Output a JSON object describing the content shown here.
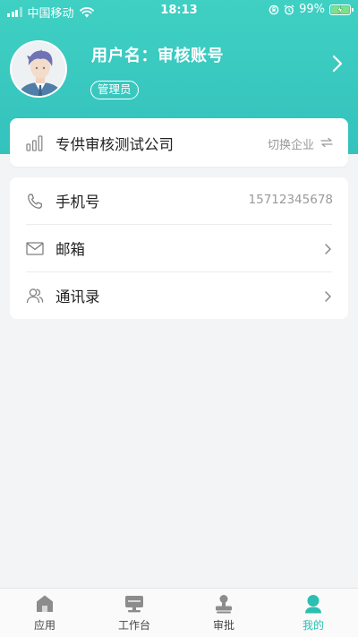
{
  "status_bar": {
    "carrier": "中国移动",
    "time": "18:13",
    "battery_percent": "99%"
  },
  "profile": {
    "username": "用户名：审核账号",
    "role_badge": "管理员"
  },
  "company": {
    "name": "专供审核测试公司",
    "switch_label": "切换企业"
  },
  "info_rows": [
    {
      "label": "手机号",
      "value": "15712345678",
      "icon": "phone-icon"
    },
    {
      "label": "邮箱",
      "icon": "mail-icon"
    },
    {
      "label": "通讯录",
      "icon": "contacts-icon"
    }
  ],
  "tabs": [
    {
      "label": "应用",
      "icon": "home-icon",
      "active": false
    },
    {
      "label": "工作台",
      "icon": "workbench-icon",
      "active": false
    },
    {
      "label": "审批",
      "icon": "stamp-icon",
      "active": false
    },
    {
      "label": "我的",
      "icon": "user-icon",
      "active": true
    }
  ],
  "colors": {
    "accent": "#2bbfb1",
    "header_top": "#3fd0c3",
    "header_bottom": "#34c2bd",
    "background": "#f3f4f6"
  }
}
